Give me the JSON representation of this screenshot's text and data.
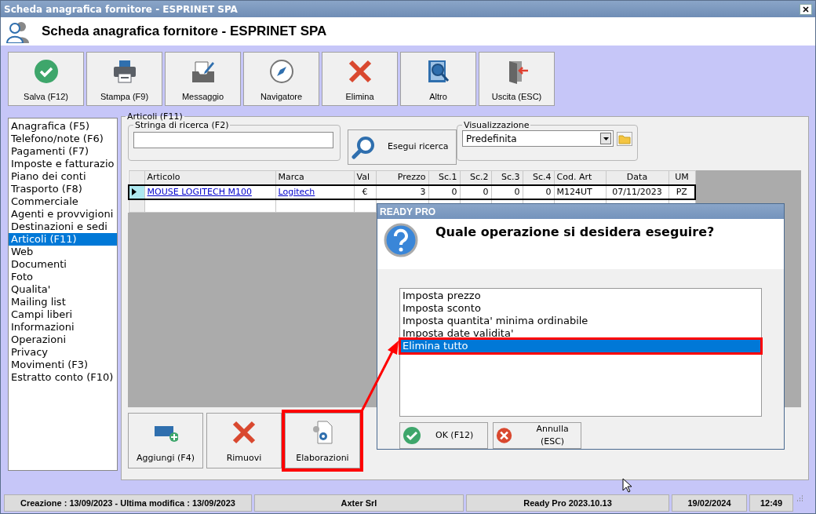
{
  "window": {
    "title": "Scheda anagrafica fornitore - ESPRINET SPA"
  },
  "header": {
    "title": "Scheda anagrafica fornitore - ESPRINET SPA"
  },
  "toolbar": [
    {
      "label": "Salva (F12)"
    },
    {
      "label": "Stampa (F9)"
    },
    {
      "label": "Messaggio"
    },
    {
      "label": "Navigatore"
    },
    {
      "label": "Elimina"
    },
    {
      "label": "Altro"
    },
    {
      "label": "Uscita (ESC)"
    }
  ],
  "sidebar": {
    "items": [
      {
        "label": "Anagrafica (F5)",
        "selected": false
      },
      {
        "label": "Telefono/note (F6)",
        "selected": false
      },
      {
        "label": "Pagamenti (F7)",
        "selected": false
      },
      {
        "label": "Imposte e fatturazio",
        "selected": false
      },
      {
        "label": "Piano dei conti",
        "selected": false
      },
      {
        "label": "Trasporto (F8)",
        "selected": false
      },
      {
        "label": "Commerciale",
        "selected": false
      },
      {
        "label": "Agenti e provvigioni",
        "selected": false
      },
      {
        "label": "Destinazioni e sedi",
        "selected": false
      },
      {
        "label": "Articoli (F11)",
        "selected": true
      },
      {
        "label": "Web",
        "selected": false
      },
      {
        "label": "Documenti",
        "selected": false
      },
      {
        "label": "Foto",
        "selected": false
      },
      {
        "label": "Qualita'",
        "selected": false
      },
      {
        "label": "Mailing list",
        "selected": false
      },
      {
        "label": "Campi liberi",
        "selected": false
      },
      {
        "label": "Informazioni",
        "selected": false
      },
      {
        "label": "Operazioni",
        "selected": false
      },
      {
        "label": "Privacy",
        "selected": false
      },
      {
        "label": "Movimenti (F3)",
        "selected": false
      },
      {
        "label": "Estratto conto (F10)",
        "selected": false
      }
    ]
  },
  "panel": {
    "title": "Articoli (F11)",
    "search": {
      "label": "Stringa di ricerca (F2)",
      "button": "Esegui ricerca"
    },
    "view": {
      "label": "Visualizzazione",
      "value": "Predefinita"
    },
    "table": {
      "columns": [
        "Articolo",
        "Marca",
        "Val",
        "Prezzo",
        "Sc.1",
        "Sc.2",
        "Sc.3",
        "Sc.4",
        "Cod. Art",
        "Data",
        "UM"
      ],
      "rows": [
        {
          "current": true,
          "cells": [
            "MOUSE LOGITECH M100",
            "Logitech",
            "€",
            "3",
            "0",
            "0",
            "0",
            "0",
            "M124UT",
            "07/11/2023",
            "PZ"
          ]
        }
      ]
    },
    "buttons": [
      {
        "label": "Aggiungi (F4)",
        "highlighted": false
      },
      {
        "label": "Rimuovi",
        "highlighted": false
      },
      {
        "label": "Elaborazioni",
        "highlighted": true
      }
    ]
  },
  "dialog": {
    "title": "READY PRO",
    "question": "Quale operazione si desidera eseguire?",
    "options": [
      {
        "label": "Imposta prezzo",
        "selected": false,
        "highlighted": false
      },
      {
        "label": "Imposta sconto",
        "selected": false,
        "highlighted": false
      },
      {
        "label": "Imposta quantita' minima ordinabile",
        "selected": false,
        "highlighted": false
      },
      {
        "label": "Imposta date validita'",
        "selected": false,
        "highlighted": false
      },
      {
        "label": "Elimina tutto",
        "selected": true,
        "highlighted": true
      }
    ],
    "buttons": [
      "OK (F12)",
      "Annulla (ESC)"
    ]
  },
  "status_bar": [
    "Creazione : 13/09/2023 - Ultima modifica : 13/09/2023",
    "Axter Srl",
    "Ready Pro 2023.10.13",
    "19/02/2024",
    "12:49"
  ]
}
